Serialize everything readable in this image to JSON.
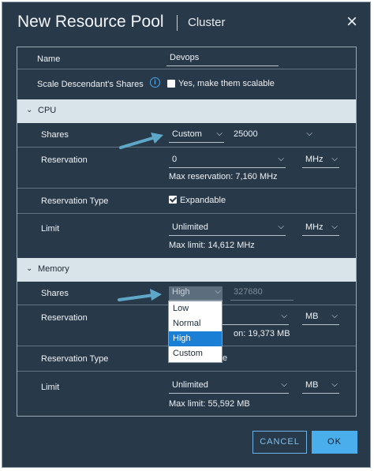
{
  "dialog": {
    "title": "New Resource Pool",
    "subtitle": "Cluster",
    "close_icon": "close-icon"
  },
  "general": {
    "name_label": "Name",
    "name_value": "Devops",
    "scale_label": "Scale Descendant's Shares",
    "scale_checkbox_label": "Yes, make them scalable",
    "scale_checked": false
  },
  "cpu": {
    "section_title": "CPU",
    "shares_label": "Shares",
    "shares_level": "Custom",
    "shares_value": "25000",
    "reservation_label": "Reservation",
    "reservation_value": "0",
    "reservation_unit": "MHz",
    "reservation_hint": "Max reservation: 7,160 MHz",
    "reservation_type_label": "Reservation Type",
    "expandable_label": "Expandable",
    "expandable_checked": true,
    "limit_label": "Limit",
    "limit_value": "Unlimited",
    "limit_unit": "MHz",
    "limit_hint": "Max limit: 14,612 MHz"
  },
  "memory": {
    "section_title": "Memory",
    "shares_label": "Shares",
    "shares_level": "High",
    "shares_value": "327680",
    "shares_options": [
      "Low",
      "Normal",
      "High",
      "Custom"
    ],
    "shares_selected_option": "High",
    "reservation_label": "Reservation",
    "reservation_unit": "MB",
    "reservation_hint_partial": "on: 19,373 MB",
    "reservation_type_label": "Reservation Type",
    "expandable_label_partial": "e",
    "limit_label": "Limit",
    "limit_value": "Unlimited",
    "limit_unit": "MB",
    "limit_hint": "Max limit: 55,592 MB"
  },
  "footer": {
    "cancel_label": "CANCEL",
    "ok_label": "OK"
  },
  "colors": {
    "dialog_bg": "#28394a",
    "section_bg": "#d9e3ea",
    "accent": "#49aeeb",
    "selection": "#1c7fd6",
    "annotation_arrow": "#5fa7c8"
  }
}
